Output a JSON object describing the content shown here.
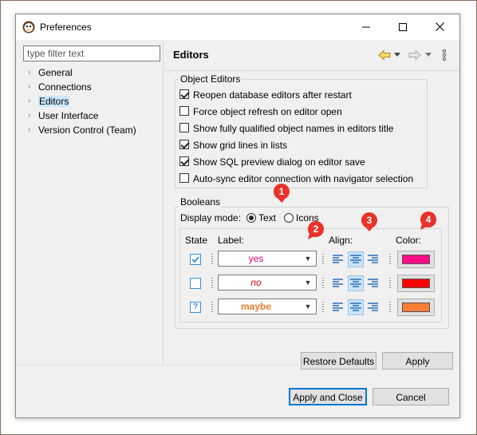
{
  "window": {
    "title": "Preferences",
    "minimize_glyph": "—",
    "maximize_glyph": "☐",
    "close_glyph": "✕"
  },
  "sidebar": {
    "filter_placeholder": "type filter text",
    "items": [
      {
        "label": "General",
        "selected": false
      },
      {
        "label": "Connections",
        "selected": false
      },
      {
        "label": "Editors",
        "selected": true
      },
      {
        "label": "User Interface",
        "selected": false
      },
      {
        "label": "Version Control (Team)",
        "selected": false
      }
    ],
    "chevron_glyph": "›"
  },
  "page": {
    "title": "Editors",
    "nav_icons": [
      "back-arrow-icon",
      "dropdown-icon",
      "forward-arrow-icon",
      "dropdown-icon",
      "more-options-icon"
    ]
  },
  "object_editors": {
    "title": "Object Editors",
    "options": [
      {
        "label": "Reopen database editors after restart",
        "checked": true
      },
      {
        "label": "Force object refresh on editor open",
        "checked": false
      },
      {
        "label": "Show fully qualified object names in editors title",
        "checked": false
      },
      {
        "label": "Show grid lines in lists",
        "checked": true
      },
      {
        "label": "Show SQL preview dialog on editor save",
        "checked": true
      },
      {
        "label": "Auto-sync editor connection with navigator selection",
        "checked": false
      }
    ]
  },
  "booleans": {
    "title": "Booleans",
    "display_mode_label": "Display mode:",
    "mode_text": "Text",
    "mode_icons": "Icons",
    "selected_mode": "Text",
    "headers": {
      "state": "State",
      "label": "Label:",
      "align": "Align:",
      "color": "Color:"
    },
    "rows": [
      {
        "state": "checked",
        "label": "yes",
        "label_color": "#e0007a",
        "italic": false,
        "bold": false,
        "align": "center",
        "color": "#ff0b8a"
      },
      {
        "state": "unchecked",
        "label": "no",
        "label_color": "#e00000",
        "italic": true,
        "bold": false,
        "align": "center",
        "color": "#ff0000"
      },
      {
        "state": "unknown",
        "label": "maybe",
        "label_color": "#f07a2a",
        "italic": false,
        "bold": true,
        "align": "center",
        "color": "#ff7f3a"
      }
    ],
    "unknown_state_glyph": "?"
  },
  "callouts": [
    "1",
    "2",
    "3",
    "4"
  ],
  "callout_color": "#e8322a",
  "buttons": {
    "restore_defaults": "Restore Defaults",
    "apply": "Apply",
    "apply_and_close": "Apply and Close",
    "cancel": "Cancel"
  }
}
